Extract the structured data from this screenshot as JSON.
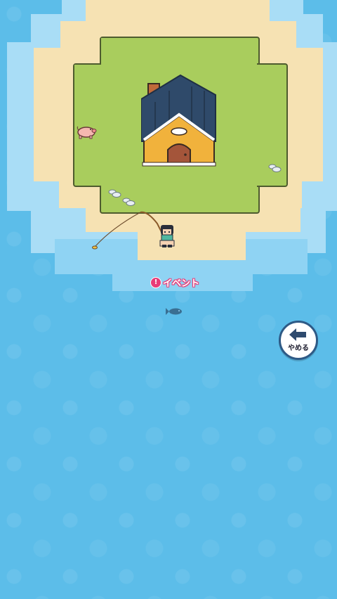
{
  "event": {
    "icon_text": "!",
    "label": "イベント"
  },
  "quit_button": {
    "label": "やめる",
    "icon": "back-arrow-icon"
  },
  "colors": {
    "water": "#5cbde9",
    "shallow": "#8fd3f3",
    "sand": "#f6e2b3",
    "grass": "#a9cd5d",
    "roof": "#2f4a6a",
    "wall": "#f1b23c",
    "accent": "#e83c78"
  }
}
